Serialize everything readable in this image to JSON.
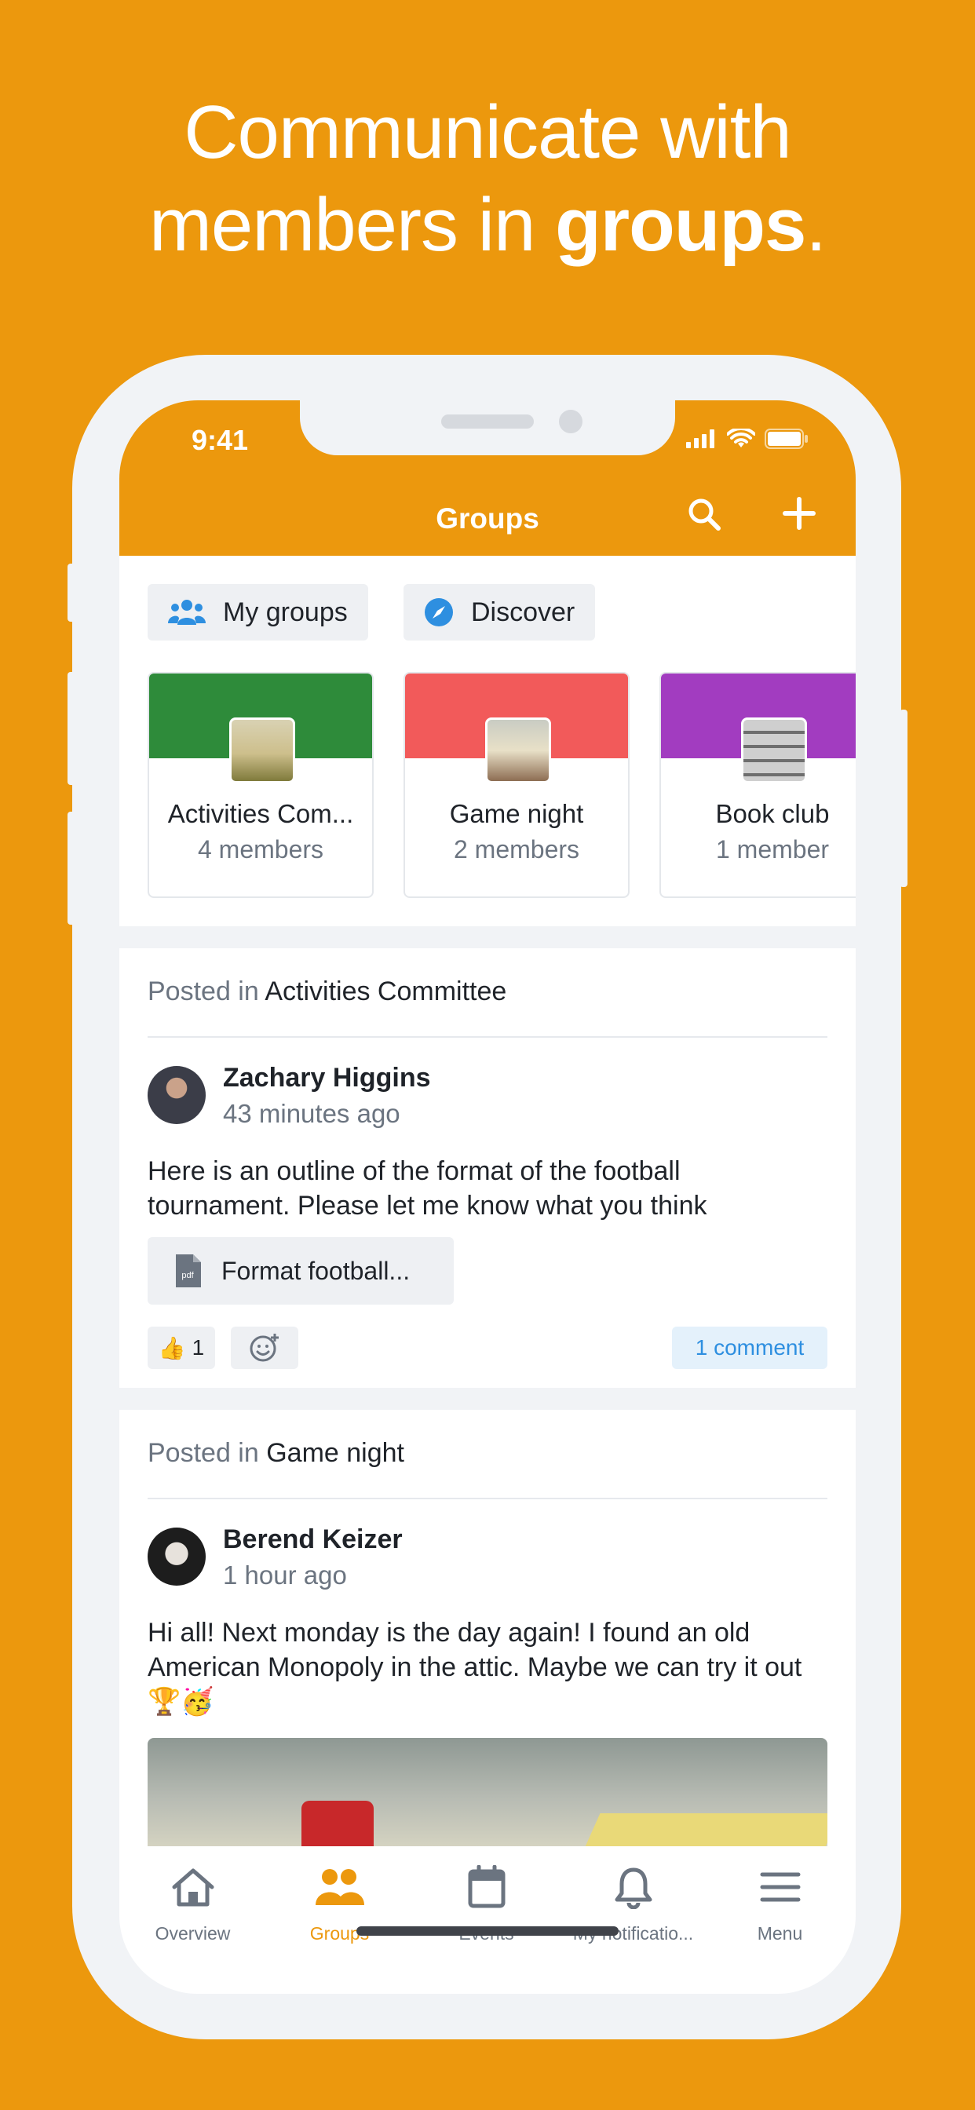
{
  "headline": {
    "line1": "Communicate with",
    "line2_prefix": "members in ",
    "line2_bold": "groups",
    "line2_suffix": "."
  },
  "status_bar": {
    "time": "9:41",
    "icons": [
      "signal-icon",
      "wifi-icon",
      "battery-icon"
    ]
  },
  "header": {
    "title": "Groups",
    "icons": [
      "search-icon",
      "plus-icon"
    ]
  },
  "accent_color": "#EC980D",
  "chips": [
    {
      "label": "My groups",
      "icon": "users-icon"
    },
    {
      "label": "Discover",
      "icon": "compass-icon"
    }
  ],
  "groups": [
    {
      "name": "Activities Com...",
      "members": "4 members",
      "banner_color": "#2E8B3A"
    },
    {
      "name": "Game night",
      "members": "2 members",
      "banner_color": "#F25A5A"
    },
    {
      "name": "Book club",
      "members": "1 member",
      "banner_color": "#A23CC0"
    }
  ],
  "posts": [
    {
      "posted_prefix": "Posted in ",
      "group": "Activities Committee",
      "author": "Zachary Higgins",
      "ago": "43 minutes ago",
      "text": "Here is an outline of the format of the football tournament. Please let me know what you think",
      "attachment": "Format football...",
      "reaction_emoji": "👍",
      "reaction_count": "1",
      "comments": "1 comment"
    },
    {
      "posted_prefix": "Posted in ",
      "group": "Game night",
      "author": "Berend Keizer",
      "ago": "1 hour ago",
      "text": "Hi all! Next monday is the day again! I found an old American Monopoly in the attic. Maybe we can try it out 🏆🥳"
    }
  ],
  "tabs": [
    {
      "label": "Overview",
      "icon": "home-icon",
      "active": false
    },
    {
      "label": "Groups",
      "icon": "groups-icon",
      "active": true
    },
    {
      "label": "Events",
      "icon": "calendar-icon",
      "active": false
    },
    {
      "label": "My notificatio...",
      "icon": "bell-icon",
      "active": false
    },
    {
      "label": "Menu",
      "icon": "menu-icon",
      "active": false
    }
  ]
}
